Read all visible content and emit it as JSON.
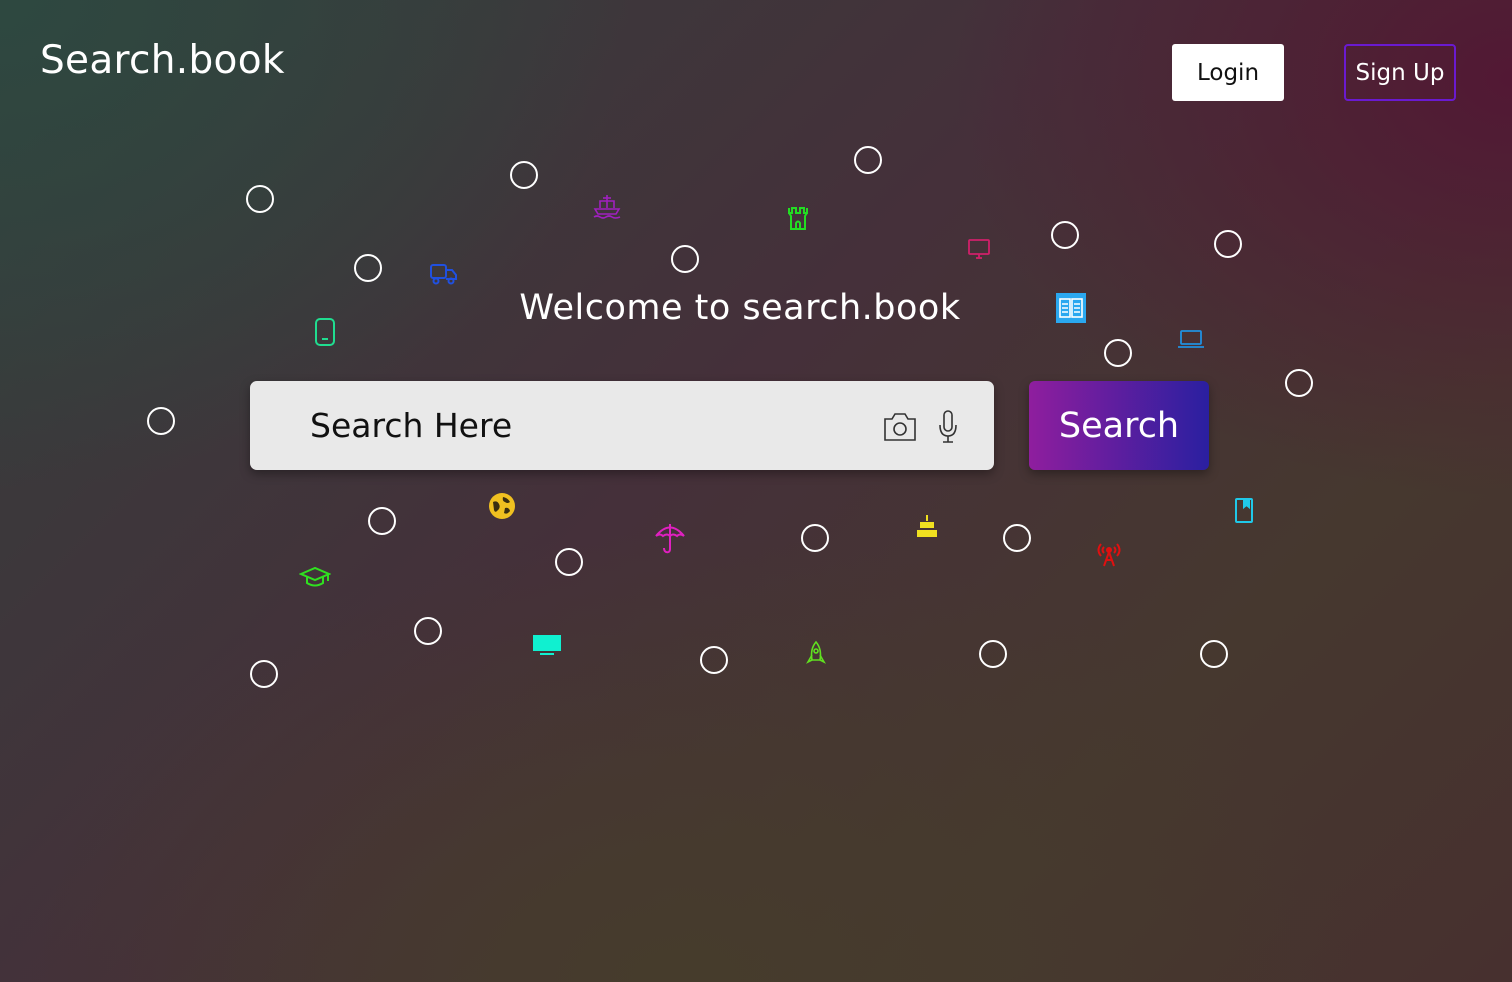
{
  "brand": {
    "logo_text": "Search.book"
  },
  "nav": {
    "login_label": "Login",
    "signup_label": "Sign Up"
  },
  "hero": {
    "welcome_text": "Welcome to search.book"
  },
  "search": {
    "placeholder": "Search Here",
    "button_label": "Search",
    "camera_icon": "camera-icon",
    "mic_icon": "microphone-icon"
  },
  "theme": {
    "text_color": "#ffffff",
    "search_box_bg": "#e9e9e9",
    "search_button_gradient": [
      "#8f1e9e",
      "#2a1fa0"
    ],
    "signup_border": "#6a1ad0"
  },
  "decor_icons": [
    {
      "name": "ship-icon",
      "color": "#a020c0"
    },
    {
      "name": "castle-icon",
      "color": "#22dd22"
    },
    {
      "name": "monitor-icon",
      "color": "#d0206a"
    },
    {
      "name": "truck-icon",
      "color": "#2050e0"
    },
    {
      "name": "mobile-phone-icon",
      "color": "#20dd90"
    },
    {
      "name": "book-reader-icon",
      "color": "#2aa8f0"
    },
    {
      "name": "laptop-icon",
      "color": "#2090e0"
    },
    {
      "name": "globe-icon",
      "color": "#f0c020"
    },
    {
      "name": "umbrella-icon",
      "color": "#e020c0"
    },
    {
      "name": "cake-icon",
      "color": "#f0e020"
    },
    {
      "name": "radio-tower-icon",
      "color": "#e01010"
    },
    {
      "name": "book-icon",
      "color": "#20c8e8"
    },
    {
      "name": "graduation-cap-icon",
      "color": "#30e020"
    },
    {
      "name": "tv-icon",
      "color": "#10f0d0"
    },
    {
      "name": "rocket-icon",
      "color": "#60e020"
    }
  ]
}
